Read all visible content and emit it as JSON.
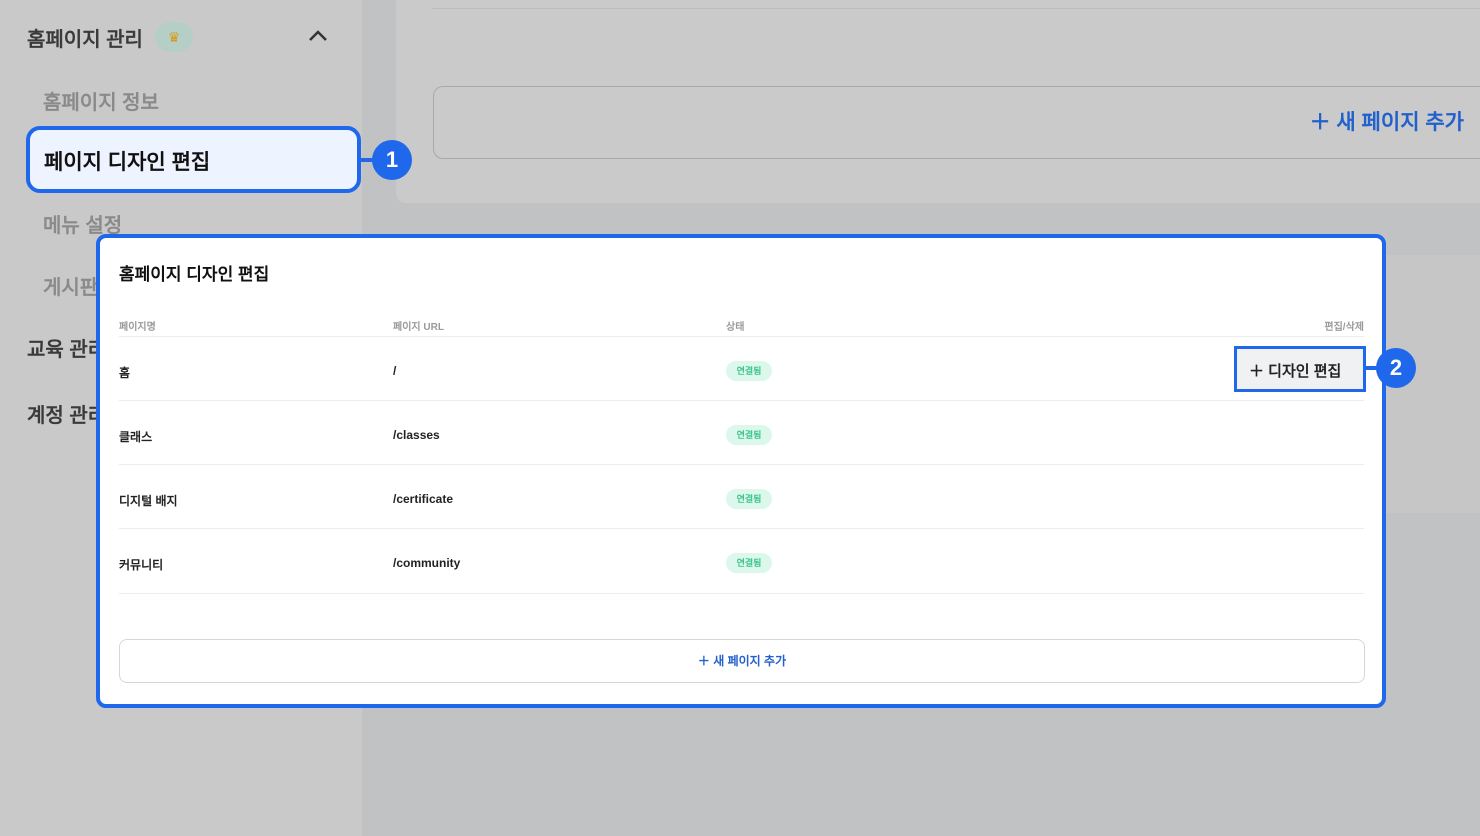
{
  "sidebar": {
    "group_homepage": "홈페이지 관리",
    "items": [
      "홈페이지 정보",
      "페이지 디자인 편집",
      "메뉴 설정",
      "게시판"
    ],
    "group_education": "교육 관리",
    "group_account": "계정 관리"
  },
  "background": {
    "add_page_label": "새 페이지 추가"
  },
  "badges": {
    "one": "1",
    "two": "2"
  },
  "modal": {
    "title": "홈페이지 디자인 편집",
    "columns": [
      "페이지명",
      "페이지 URL",
      "상태",
      "편집/삭제"
    ],
    "rows": [
      {
        "name": "홈",
        "url": "/",
        "status": "연결됨"
      },
      {
        "name": "클래스",
        "url": "/classes",
        "status": "연결됨"
      },
      {
        "name": "디지털 배지",
        "url": "/certificate",
        "status": "연결됨"
      },
      {
        "name": "커뮤니티",
        "url": "/community",
        "status": "연결됨"
      }
    ],
    "edit_button": "디자인 편집",
    "add_page": "새 페이지 추가"
  },
  "colors": {
    "accent": "#1f67eb",
    "status": "#3cc48c"
  }
}
